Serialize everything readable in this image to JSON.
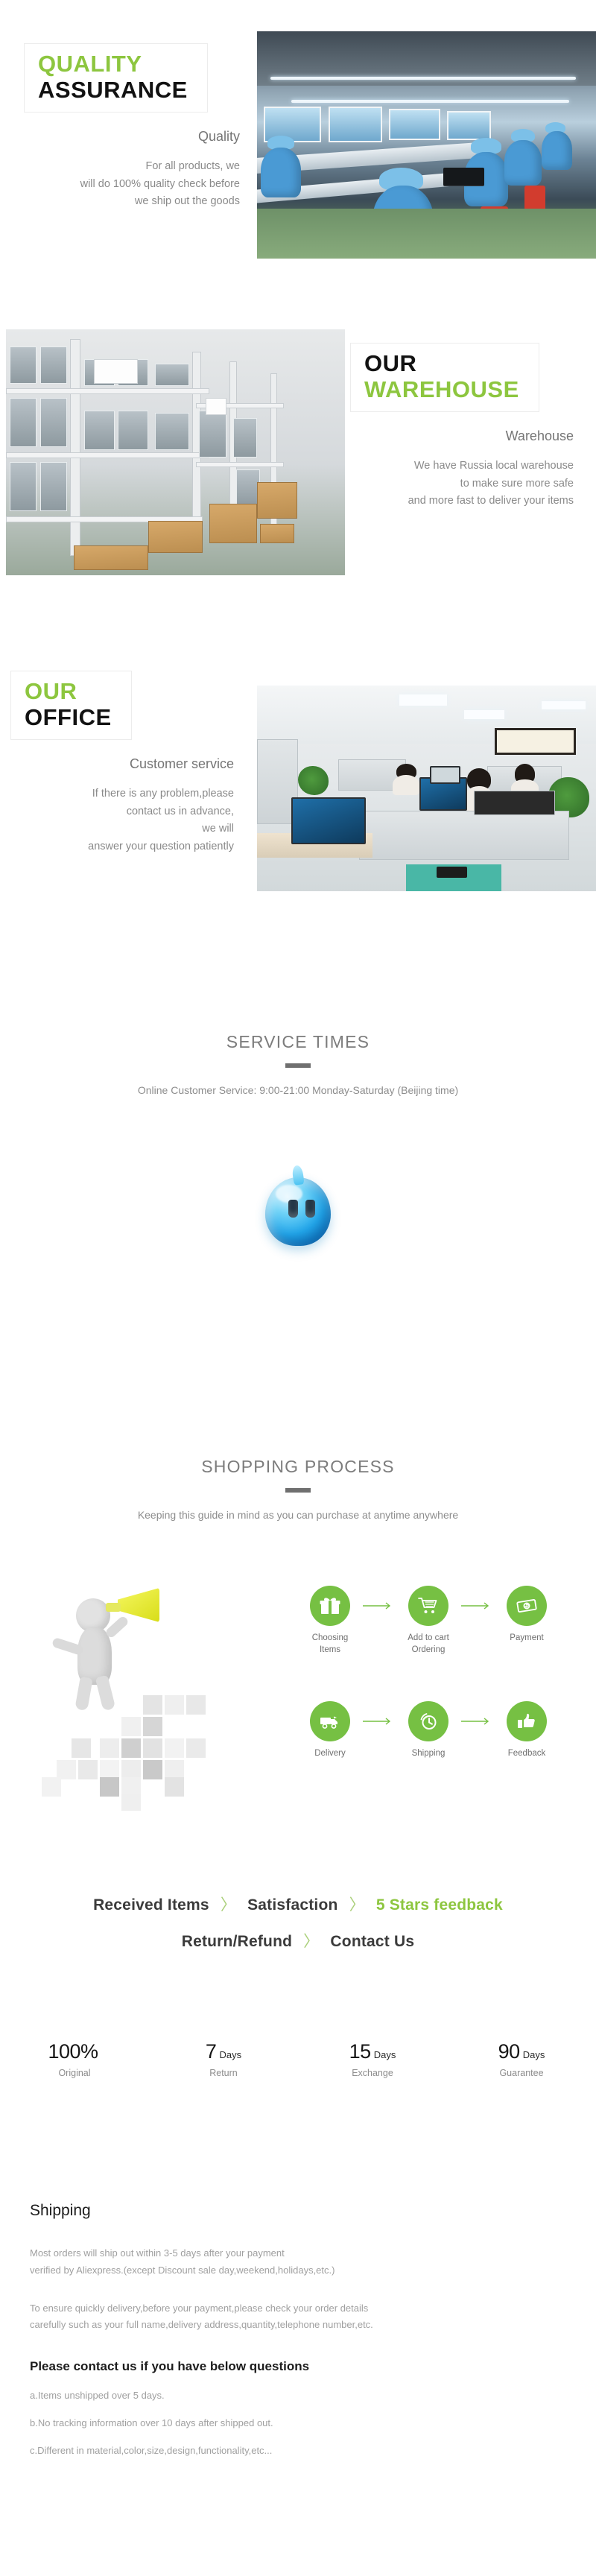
{
  "quality": {
    "title_line1": "QUALITY",
    "title_line2": "ASSURANCE",
    "subtitle": "Quality",
    "body": "For all products,  we\nwill do 100% quality check before\nwe ship out the goods",
    "photo_alt": "factory-assembly-line-photo"
  },
  "warehouse": {
    "title_line1": "OUR",
    "title_line2": "WAREHOUSE",
    "subtitle": "Warehouse",
    "body": "We have Russia local warehouse\nto make sure more safe\nand more fast to deliver your items",
    "photo_alt": "warehouse-shelving-photo"
  },
  "office": {
    "title_line1": "OUR",
    "title_line2": "OFFICE",
    "subtitle": "Customer service",
    "body": "If there is any problem,please\ncontact us in advance,\nwe will\nanswer your question patiently",
    "photo_alt": "office-interior-photo"
  },
  "service_times": {
    "heading": "SERVICE TIMES",
    "detail": "Online Customer Service: 9:00-21:00 Monday-Saturday (Beijing time)",
    "icon": "trademanager-chat-icon"
  },
  "shopping_process": {
    "heading": "SHOPPING PROCESS",
    "subtitle": "Keeping this guide in mind as you can purchase at anytime anywhere",
    "mascot_alt": "megaphone-mascot-illustration",
    "steps_row1": [
      {
        "label": "Choosing\nItems",
        "icon": "gift-box-icon"
      },
      {
        "label": "Add to cart\nOrdering",
        "icon": "shopping-cart-icon"
      },
      {
        "label": "Payment",
        "icon": "banknote-icon"
      }
    ],
    "steps_row2": [
      {
        "label": "Delivery",
        "icon": "delivery-truck-icon"
      },
      {
        "label": "Shipping",
        "icon": "clock-icon"
      },
      {
        "label": "Feedback",
        "icon": "thumbs-up-icon"
      }
    ]
  },
  "flow": {
    "line1": [
      "Received Items",
      "Satisfaction",
      "5 Stars feedback"
    ],
    "line2": [
      "Return/Refund",
      "Contact Us"
    ],
    "separator": "〉",
    "highlight_color": "#8dc63f"
  },
  "stats": [
    {
      "num": "100%",
      "unit": "",
      "caption": "Original"
    },
    {
      "num": "7",
      "unit": "Days",
      "caption": "Return"
    },
    {
      "num": "15",
      "unit": "Days",
      "caption": "Exchange"
    },
    {
      "num": "90",
      "unit": "Days",
      "caption": "Guarantee"
    }
  ],
  "shipping": {
    "heading": "Shipping",
    "para1": "Most orders will ship out within 3-5 days after your payment\nverified by Aliexpress.(except Discount sale day,weekend,holidays,etc.)",
    "para2": "To ensure quickly delivery,before your payment,please check your order details\ncarefully such as your full name,delivery address,quantity,telephone number,etc.",
    "questions_heading": "Please contact us if you have below questions",
    "q_a": "a.Items unshipped over 5 days.",
    "q_b": "b.No tracking information over 10 days after shipped out.",
    "q_c": "c.Different in material,color,size,design,functionality,etc..."
  },
  "colors": {
    "green": "#8dc63f",
    "icon_green": "#76c043",
    "body_gray": "#8a8a8a"
  }
}
